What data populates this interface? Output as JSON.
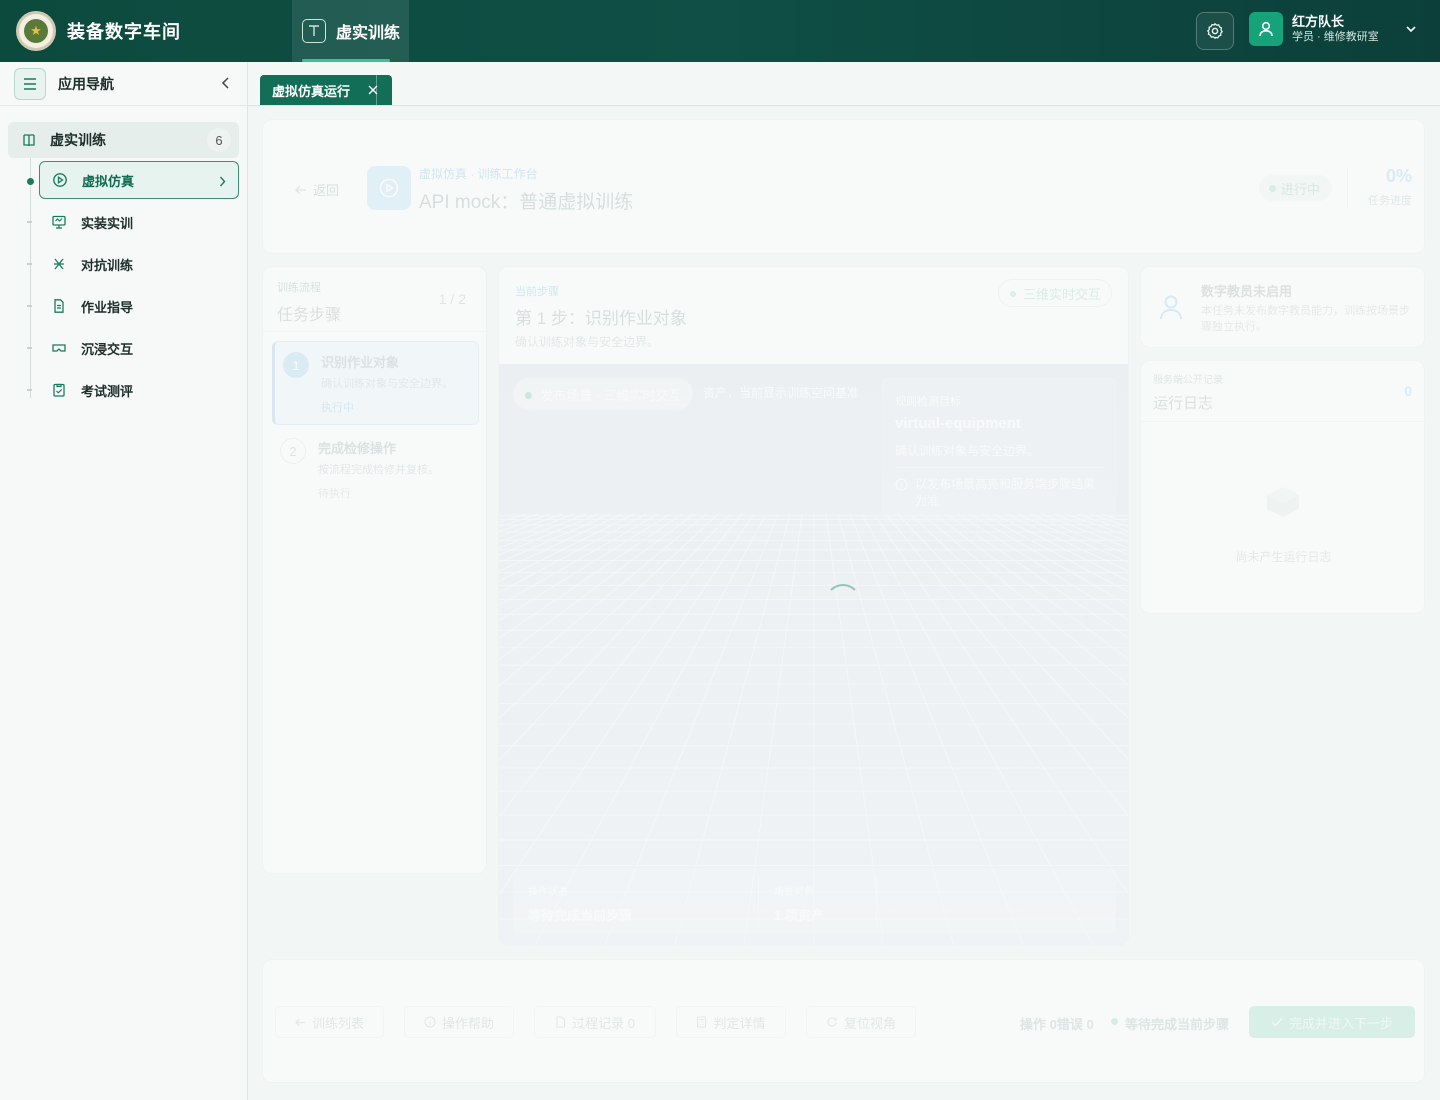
{
  "app": {
    "title": "装备数字车间",
    "logo_glyph": "★"
  },
  "top_nav": {
    "active_tab": "虚实训练"
  },
  "user": {
    "name": "红方队长",
    "role": "学员 · 维修教研室"
  },
  "sidebar": {
    "title": "应用导航",
    "group": {
      "label": "虚实训练",
      "count": "6"
    },
    "items": [
      {
        "label": "虚拟仿真",
        "icon": "play-circle-icon",
        "active": true
      },
      {
        "label": "实装实训",
        "icon": "monitor-icon",
        "active": false
      },
      {
        "label": "对抗训练",
        "icon": "sword-icon",
        "active": false
      },
      {
        "label": "作业指导",
        "icon": "document-icon",
        "active": false
      },
      {
        "label": "沉浸交互",
        "icon": "vr-goggles-icon",
        "active": false
      },
      {
        "label": "考试测评",
        "icon": "clipboard-icon",
        "active": false
      }
    ]
  },
  "page_tab": {
    "label": "虚拟仿真运行"
  },
  "header": {
    "back": "返回",
    "breadcrumb": "虚拟仿真 · 训练工作台",
    "title": "API mock：普通虚拟训练",
    "status": "进行中",
    "progress_value": "0%",
    "progress_label": "任务进度"
  },
  "flow": {
    "top_label": "训练流程",
    "title": "任务步骤",
    "count": "1 / 2",
    "steps": [
      {
        "num": "1",
        "title": "识别作业对象",
        "desc": "确认训练对象与安全边界。",
        "status": "执行中"
      },
      {
        "num": "2",
        "title": "完成检修操作",
        "desc": "按流程完成检修并复核。",
        "status": "待执行"
      }
    ]
  },
  "stage": {
    "label": "当前步骤",
    "title": "第 1 步：识别作业对象",
    "subtitle": "确认训练对象与安全边界。",
    "mode": "三维实时交互",
    "scene_pill": "发布场景 · 三维实时交互",
    "scene_note": "资产，当前显示训练空间基准",
    "target": {
      "label": "规则检测目标",
      "name": "virtual-equipment",
      "desc": "确认训练对象与安全边界。",
      "note": "以发布场景高亮和服务端步骤结果为准"
    },
    "info": [
      {
        "key": "操作状态",
        "value": "等待完成当前步骤"
      },
      {
        "key": "场景对象",
        "value": "1 项资产"
      }
    ]
  },
  "coach": {
    "title": "数字教员未启用",
    "desc": "本任务未发布数字教员能力，训练按场景步骤独立执行。"
  },
  "log": {
    "top_label": "服务端公开记录",
    "title": "运行日志",
    "count": "0",
    "empty": "尚未产生运行日志"
  },
  "footer": {
    "buttons": [
      {
        "label": "训练列表",
        "icon": "arrow-left-icon"
      },
      {
        "label": "操作帮助",
        "icon": "info-icon"
      },
      {
        "label": "过程记录 0",
        "icon": "file-icon"
      },
      {
        "label": "判定详情",
        "icon": "calculator-icon"
      },
      {
        "label": "复位视角",
        "icon": "refresh-icon"
      }
    ],
    "stats": "操作 0错误 0",
    "state": "等待完成当前步骤",
    "next": "完成并进入下一步"
  },
  "colors": {
    "brand": "#0f4f45",
    "accent": "#126e56",
    "active_green": "#1b7b5f"
  }
}
